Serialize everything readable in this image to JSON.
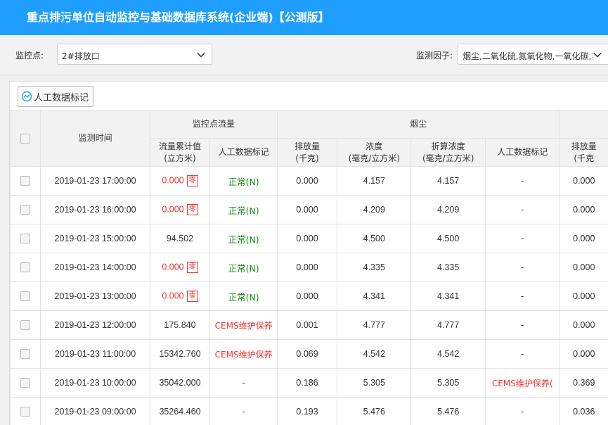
{
  "header": {
    "title": "重点排污单位自动监控与基础数据库系统(企业端)【公测版】"
  },
  "filters": {
    "point_label": "监控点:",
    "point_value": "2#排放口",
    "factor_label": "监测因子:",
    "factor_value": "烟尘,二氧化硫,氮氧化物,一氧化碳,氯"
  },
  "toolbar": {
    "mark_button": "人工数据标记"
  },
  "table": {
    "col_time": "监测时间",
    "group_flow": "监控点流量",
    "group_smoke": "烟尘",
    "flow_total": "流量累计值",
    "flow_total_unit": "(立方米)",
    "flow_mark": "人工数据标记",
    "smoke_emission": "排放量",
    "smoke_emission_unit": "(千克)",
    "smoke_conc": "浓度",
    "smoke_conc_unit": "(毫克/立方米)",
    "smoke_fold": "折算浓度",
    "smoke_fold_unit": "(毫克/立方米)",
    "smoke_mark": "人工数据标记",
    "next_emission": "排放量",
    "next_emission_unit": "(千克",
    "zero_badge": "零",
    "rows": [
      {
        "time": "2019-01-23 17:00:00",
        "flow": "0.000",
        "flow_zero": true,
        "flow_mark": "正常(N)",
        "emission": "0.000",
        "conc": "4.157",
        "fold": "4.157",
        "smoke_mark": "-",
        "next": "0.000"
      },
      {
        "time": "2019-01-23 16:00:00",
        "flow": "0.000",
        "flow_zero": true,
        "flow_mark": "正常(N)",
        "emission": "0.000",
        "conc": "4.209",
        "fold": "4.209",
        "smoke_mark": "-",
        "next": "0.000"
      },
      {
        "time": "2019-01-23 15:00:00",
        "flow": "94.502",
        "flow_zero": false,
        "flow_mark": "正常(N)",
        "emission": "0.000",
        "conc": "4.500",
        "fold": "4.500",
        "smoke_mark": "-",
        "next": "0.000"
      },
      {
        "time": "2019-01-23 14:00:00",
        "flow": "0.000",
        "flow_zero": true,
        "flow_mark": "正常(N)",
        "emission": "0.000",
        "conc": "4.335",
        "fold": "4.335",
        "smoke_mark": "-",
        "next": "0.000"
      },
      {
        "time": "2019-01-23 13:00:00",
        "flow": "0.000",
        "flow_zero": true,
        "flow_mark": "正常(N)",
        "emission": "0.000",
        "conc": "4.341",
        "fold": "4.341",
        "smoke_mark": "-",
        "next": "0.000"
      },
      {
        "time": "2019-01-23 12:00:00",
        "flow": "175.840",
        "flow_zero": false,
        "flow_mark": "CEMS维护保养",
        "emission": "0.001",
        "conc": "4.777",
        "fold": "4.777",
        "smoke_mark": "-",
        "next": "0.000"
      },
      {
        "time": "2019-01-23 11:00:00",
        "flow": "15342.760",
        "flow_zero": false,
        "flow_mark": "CEMS维护保养",
        "emission": "0.069",
        "conc": "4.542",
        "fold": "4.542",
        "smoke_mark": "-",
        "next": "0.000"
      },
      {
        "time": "2019-01-23 10:00:00",
        "flow": "35042.000",
        "flow_zero": false,
        "flow_mark": "-",
        "emission": "0.186",
        "conc": "5.305",
        "fold": "5.305",
        "smoke_mark": "CEMS维护保养(",
        "next": "0.369"
      },
      {
        "time": "2019-01-23 09:00:00",
        "flow": "35264.460",
        "flow_zero": false,
        "flow_mark": "-",
        "emission": "0.193",
        "conc": "5.476",
        "fold": "5.476",
        "smoke_mark": "-",
        "next": "0.036"
      }
    ]
  },
  "colors": {
    "header_bg": "#1e9fff",
    "alert": "#e33333",
    "normal": "#1a8f1a"
  },
  "icons": {
    "chevron": "chevron-down-icon",
    "chart": "line-chart-icon"
  }
}
